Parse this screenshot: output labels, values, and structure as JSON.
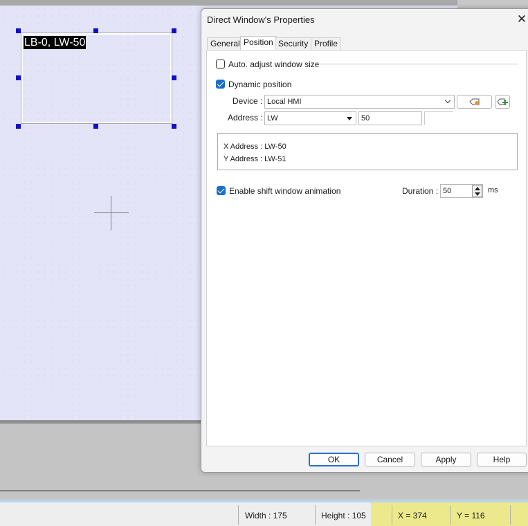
{
  "canvas": {
    "window_label": "LB-0, LW-50"
  },
  "dialog": {
    "title": "Direct Window's Properties",
    "close_glyph": "✕",
    "tabs": [
      {
        "label": "General",
        "active": false
      },
      {
        "label": "Position",
        "active": true
      },
      {
        "label": "Security",
        "active": false
      },
      {
        "label": "Profile",
        "active": false
      }
    ],
    "auto_adjust": {
      "label": "Auto. adjust window size",
      "checked": false
    },
    "dynamic_position": {
      "label": "Dynamic position",
      "checked": true
    },
    "device": {
      "label": "Device :",
      "value": "Local HMI"
    },
    "address": {
      "label": "Address :",
      "type": "LW",
      "value": "50"
    },
    "address_info": {
      "x": "X Address : LW-50",
      "y": "Y Address : LW-51"
    },
    "shift_animation": {
      "label": "Enable shift window animation",
      "checked": true
    },
    "duration": {
      "label": "Duration :",
      "value": "50",
      "unit": "ms"
    },
    "buttons": {
      "ok": "OK",
      "cancel": "Cancel",
      "apply": "Apply",
      "help": "Help"
    }
  },
  "status_bar": {
    "width": "Width : 175",
    "height": "Height : 105",
    "x": "X = 374",
    "y": "Y = 116"
  },
  "colors": {
    "canvas_bg": "#e4e4f8",
    "handle": "#1010c8",
    "checkbox_checked": "#1a6ecc",
    "status_highlight": "#ece98c"
  }
}
